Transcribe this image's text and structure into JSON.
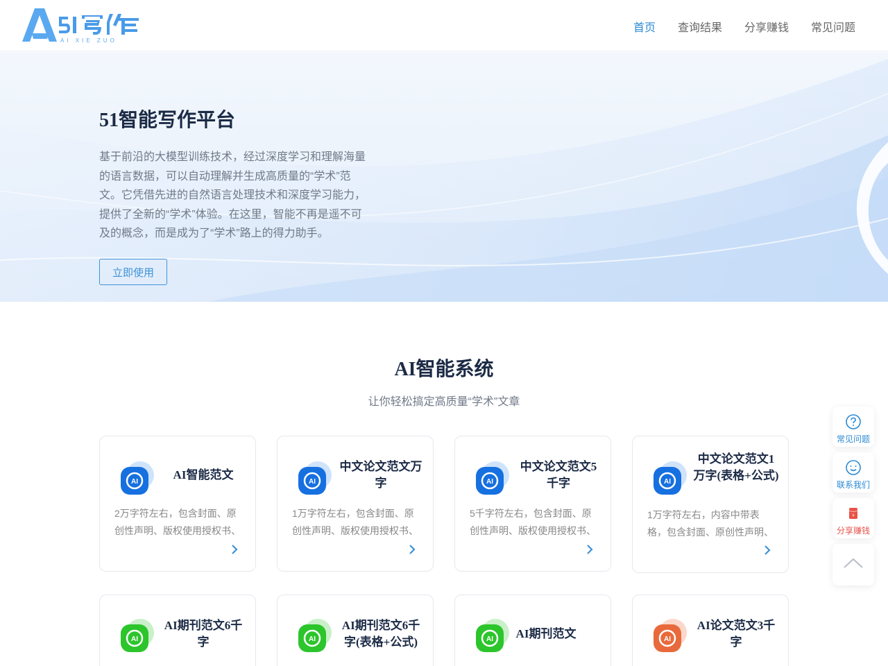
{
  "header": {
    "logo_text": "51写作",
    "logo_sub": "AI XIE ZUO",
    "nav": [
      {
        "label": "首页",
        "active": true
      },
      {
        "label": "查询结果",
        "active": false
      },
      {
        "label": "分享赚钱",
        "active": false
      },
      {
        "label": "常见问题",
        "active": false
      }
    ]
  },
  "hero": {
    "title": "51智能写作平台",
    "description": "基于前沿的大模型训练技术，经过深度学习和理解海量的语言数据，可以自动理解并生成高质量的“学术”范文。它凭借先进的自然语言处理技术和深度学习能力，提供了全新的“学术”体验。在这里，智能不再是遥不可及的概念，而是成为了“学术”路上的得力助手。",
    "button": "立即使用"
  },
  "section": {
    "title": "AI智能系统",
    "subtitle": "让你轻松搞定高质量“学术”文章"
  },
  "cards": [
    {
      "title": "AI智能范文",
      "desc": "2万字符左右，包含封面、原创性声明、版权使用授权书、",
      "icon": "ai-icon-blue"
    },
    {
      "title": "中文论文范文万字",
      "desc": "1万字符左右，包含封面、原创性声明、版权使用授权书、",
      "icon": "ai-icon-blue"
    },
    {
      "title": "中文论文范文5千字",
      "desc": "5千字符左右，包含封面、原创性声明、版权使用授权书、",
      "icon": "ai-icon-blue"
    },
    {
      "title": "中文论文范文1万字(表格+公式)",
      "desc": "1万字符左右，内容中带表格，包含封面、原创性声明、",
      "icon": "ai-icon-blue"
    },
    {
      "title": "AI期刊范文6千字",
      "desc": "",
      "icon": "ai-icon-green"
    },
    {
      "title": "AI期刊范文6千字(表格+公式)",
      "desc": "",
      "icon": "ai-icon-green"
    },
    {
      "title": "AI期刊范文",
      "desc": "",
      "icon": "ai-icon-green"
    },
    {
      "title": "AI论文范文3千字",
      "desc": "",
      "icon": "ai-icon-orange"
    }
  ],
  "float": {
    "faq": "常见问题",
    "contact": "联系我们",
    "share": "分享赚钱"
  },
  "colors": {
    "accent": "#2a8ad4",
    "title": "#1b2a45",
    "blue_icon": "#1670e0",
    "green_icon": "#2cc52c",
    "orange_icon": "#e86a3c",
    "share_red": "#e8524a"
  }
}
